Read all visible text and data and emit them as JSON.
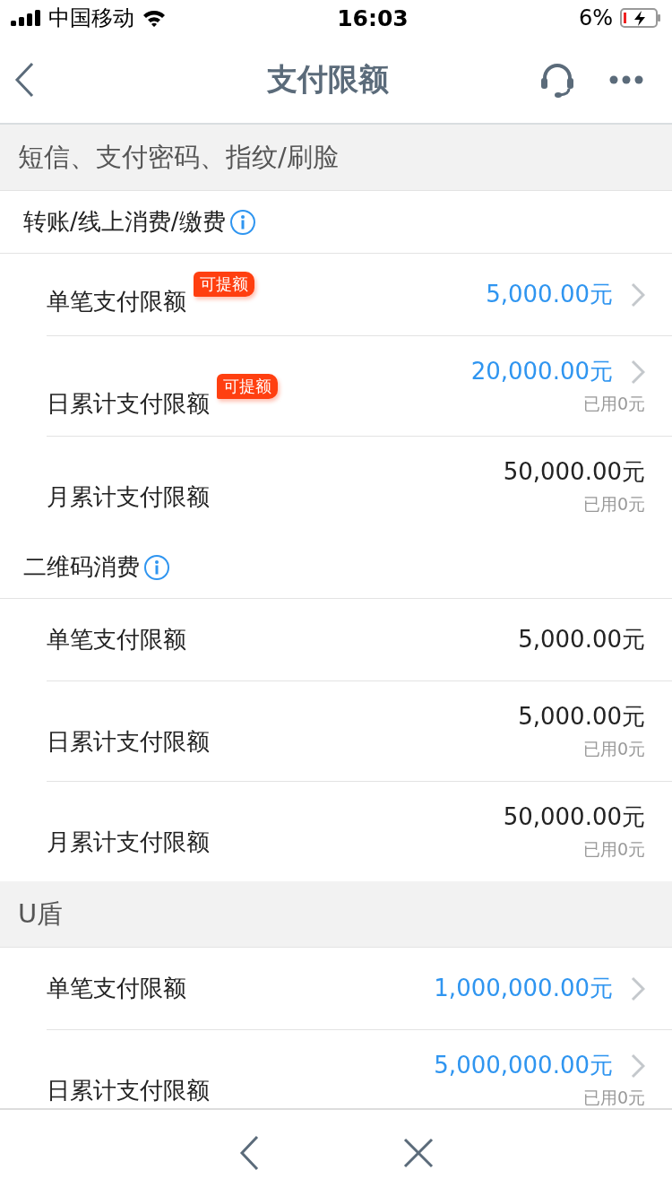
{
  "status_bar": {
    "carrier": "中国移动",
    "time": "16:03",
    "battery": "6%"
  },
  "nav": {
    "title": "支付限额"
  },
  "items": [
    {
      "kind": "category",
      "title": "短信、支付密码、指纹/刷脸"
    },
    {
      "kind": "group",
      "title": "转账/线上消费/缴费"
    },
    {
      "kind": "row",
      "label": "单笔支付限额",
      "badge": "可提额",
      "amount": "5,000.00元",
      "editable": true
    },
    {
      "kind": "row",
      "label": "日累计支付限额",
      "badge": "可提额",
      "amount": "20,000.00元",
      "editable": true,
      "used": "已用0元"
    },
    {
      "kind": "row",
      "label": "月累计支付限额",
      "amount": "50,000.00元",
      "editable": false,
      "used": "已用0元"
    },
    {
      "kind": "group",
      "title": "二维码消费"
    },
    {
      "kind": "row",
      "label": "单笔支付限额",
      "amount": "5,000.00元",
      "editable": false
    },
    {
      "kind": "row",
      "label": "日累计支付限额",
      "amount": "5,000.00元",
      "editable": false,
      "used": "已用0元"
    },
    {
      "kind": "row",
      "label": "月累计支付限额",
      "amount": "50,000.00元",
      "editable": false,
      "used": "已用0元"
    },
    {
      "kind": "category",
      "title": "U盾"
    },
    {
      "kind": "row",
      "label": "单笔支付限额",
      "amount": "1,000,000.00元",
      "editable": true
    },
    {
      "kind": "row",
      "label": "日累计支付限额",
      "amount": "5,000,000.00元",
      "editable": true,
      "used": "已用0元"
    }
  ]
}
